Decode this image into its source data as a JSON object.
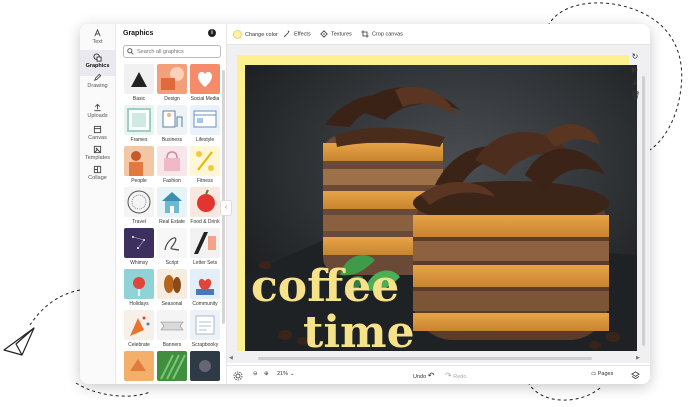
{
  "rail": {
    "items": [
      {
        "label": "Text",
        "icon": "text-icon"
      },
      {
        "label": "Graphics",
        "icon": "graphics-icon"
      },
      {
        "label": "Drawing",
        "icon": "pen-icon"
      },
      {
        "label": "Uploads",
        "icon": "upload-icon"
      },
      {
        "label": "Canvas",
        "icon": "canvas-icon"
      },
      {
        "label": "Templates",
        "icon": "templates-icon"
      },
      {
        "label": "Collage",
        "icon": "collage-icon"
      }
    ]
  },
  "panel": {
    "title": "Graphics",
    "search_placeholder": "Search all graphics",
    "categories": [
      {
        "label": "Basic"
      },
      {
        "label": "Design"
      },
      {
        "label": "Social Media"
      },
      {
        "label": "Frames"
      },
      {
        "label": "Business"
      },
      {
        "label": "Lifestyle"
      },
      {
        "label": "People"
      },
      {
        "label": "Fashion"
      },
      {
        "label": "Fitness"
      },
      {
        "label": "Travel"
      },
      {
        "label": "Real Estate"
      },
      {
        "label": "Food & Drink"
      },
      {
        "label": "Whimsy"
      },
      {
        "label": "Script"
      },
      {
        "label": "Letter Sets"
      },
      {
        "label": "Holidays"
      },
      {
        "label": "Seasonal"
      },
      {
        "label": "Community"
      },
      {
        "label": "Celebrate"
      },
      {
        "label": "Banners"
      },
      {
        "label": "Scrapbooky"
      },
      {
        "label": ""
      },
      {
        "label": ""
      },
      {
        "label": ""
      }
    ]
  },
  "toolbar": {
    "change_color": "Change color",
    "effects": "Effects",
    "textures": "Textures",
    "crop_canvas": "Crop canvas"
  },
  "canvas": {
    "line1": "coffee",
    "line2": "time",
    "background_color": "#fdf08f",
    "text_color": "#f6e28a"
  },
  "bottom": {
    "zoom": "21%",
    "undo": "Undo",
    "redo": "Redo",
    "pages": "Pages"
  }
}
